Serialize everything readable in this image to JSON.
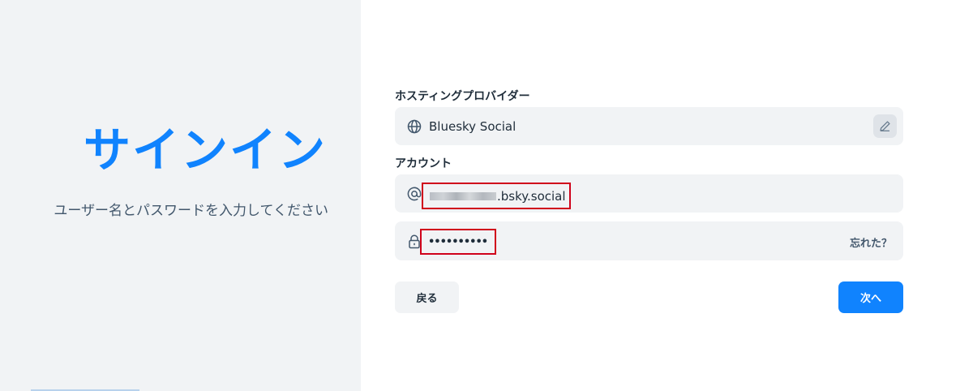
{
  "left": {
    "title": "サインイン",
    "subtitle": "ユーザー名とパスワードを入力してください"
  },
  "form": {
    "provider_label": "ホスティングプロバイダー",
    "provider_value": "Bluesky Social",
    "account_label": "アカウント",
    "handle_suffix": ".bsky.social",
    "password_masked": "••••••••••",
    "forgot_link": "忘れた？"
  },
  "actions": {
    "back_label": "戻る",
    "next_label": "次へ"
  },
  "icons": {
    "provider": "globe-icon",
    "edit": "pencil-icon",
    "handle": "at-sign-icon",
    "password": "lock-icon"
  },
  "colors": {
    "accent": "#1083fe",
    "left_panel_bg": "#f1f3f5",
    "input_bg": "#f1f3f5",
    "highlight_border": "#d0021b"
  }
}
